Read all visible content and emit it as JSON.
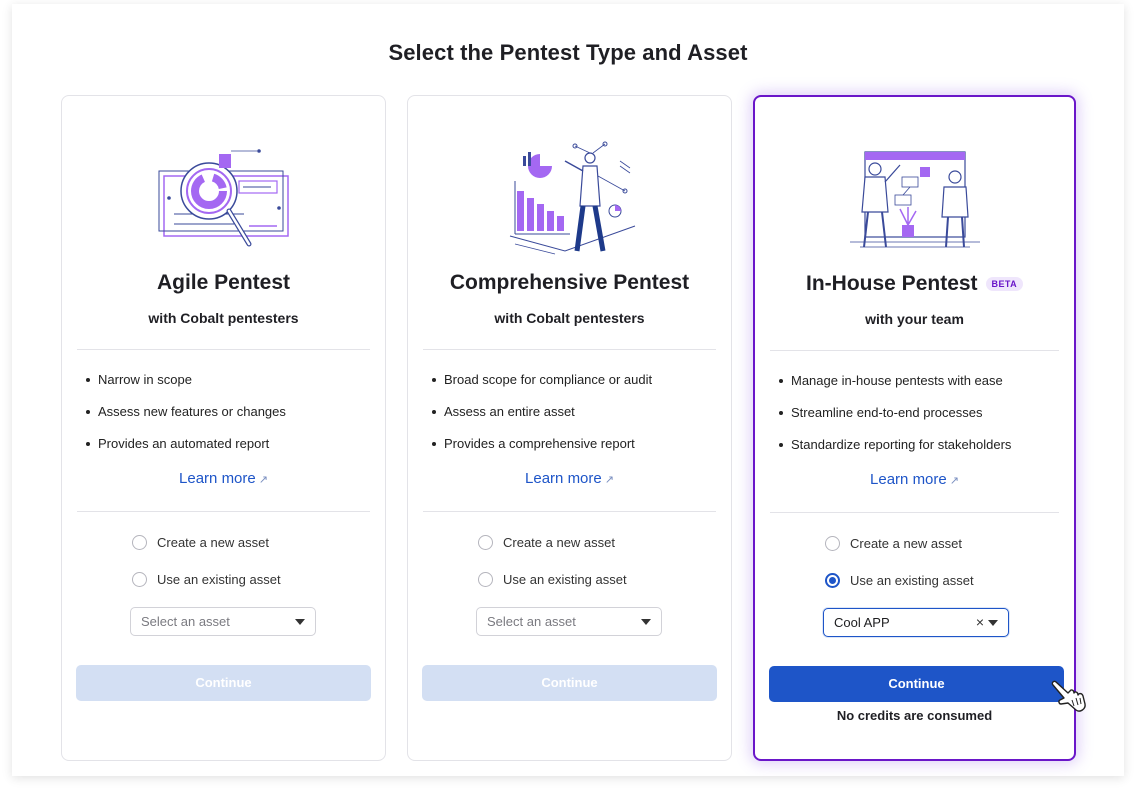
{
  "page": {
    "title": "Select the Pentest Type and Asset"
  },
  "cards": [
    {
      "title": "Agile Pentest",
      "subtitle": "with Cobalt pentesters",
      "badge": "",
      "bullets": [
        "Narrow in scope",
        "Assess new features or changes",
        "Provides an automated report"
      ],
      "learn_more": "Learn more",
      "radio_new": "Create a new asset",
      "radio_existing": "Use an existing asset",
      "selected_radio": "none",
      "select_value": "Select an asset",
      "continue": "Continue",
      "continue_enabled": false,
      "note": ""
    },
    {
      "title": "Comprehensive Pentest",
      "subtitle": "with Cobalt pentesters",
      "badge": "",
      "bullets": [
        "Broad scope for compliance or audit",
        "Assess an entire asset",
        "Provides a comprehensive report"
      ],
      "learn_more": "Learn more",
      "radio_new": "Create a new asset",
      "radio_existing": "Use an existing asset",
      "selected_radio": "none",
      "select_value": "Select an asset",
      "continue": "Continue",
      "continue_enabled": false,
      "note": ""
    },
    {
      "title": "In-House Pentest",
      "subtitle": "with your team",
      "badge": "BETA",
      "bullets": [
        "Manage in-house pentests with ease",
        "Streamline end-to-end processes",
        "Standardize reporting for stakeholders"
      ],
      "learn_more": "Learn more",
      "radio_new": "Create a new asset",
      "radio_existing": "Use an existing asset",
      "selected_radio": "existing",
      "select_value": "Cool APP",
      "clear_symbol": "×",
      "continue": "Continue",
      "continue_enabled": true,
      "note": "No credits are consumed"
    }
  ],
  "colors": {
    "accent_blue": "#1e55c8",
    "selected_border_purple": "#6a16c9",
    "illustration_purple": "#a468f2",
    "disabled_button": "#d3dff3"
  },
  "icons": [
    "magnifier-report-illustration",
    "analyst-chart-illustration",
    "team-board-illustration",
    "external-link-icon",
    "caret-down-icon",
    "hand-pointer-cursor-icon"
  ]
}
